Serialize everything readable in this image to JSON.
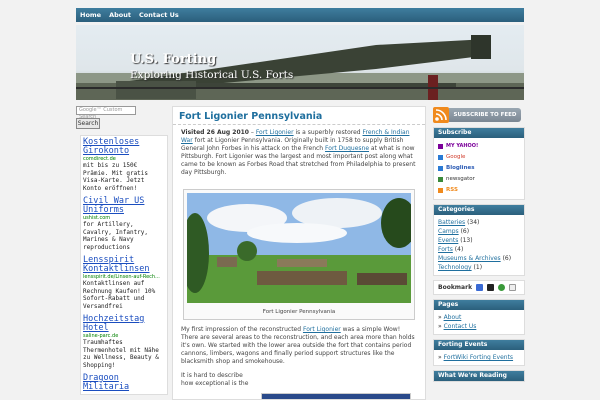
{
  "nav": [
    "Home",
    "About",
    "Contact Us"
  ],
  "site": {
    "title": "U.S. Forting",
    "description": "Exploring Historical U.S. Forts"
  },
  "search": {
    "placeholder": "Google™ Custom Search",
    "button": "Search"
  },
  "ads": [
    {
      "title": "Kostenloses Girokonto",
      "url": "comdirect.de",
      "text": "mit bis zu 150€ Prämie. Mit gratis Visa-Karte. Jetzt Konto eröffnen!"
    },
    {
      "title": "Civil War US Uniforms",
      "url": "ushist.com",
      "text": "for Artillery, Cavalry, Infantry, Marines & Navy reproductions"
    },
    {
      "title": "Lensspirit Kontaktlinsen",
      "url": "lensspirit.de/Linsen-auf-Rech...",
      "text": "Kontaktlinsen auf Rechnung Kaufen! 10% Sofort-Rabatt und Versandfrei"
    },
    {
      "title": "Hochzeitstag Hotel",
      "url": "saline-parc.de",
      "text": "Traumhaftes Thermenhotel mit Nähe zu Wellness, Beauty & Shopping!"
    },
    {
      "title": "Dragoon Militaria",
      "url": "",
      "text": ""
    }
  ],
  "post": {
    "title": "Fort Ligonier Pennsylvania",
    "meta": "Visited 26 Aug 2010",
    "intro_dash": " – ",
    "link1": "Fort Ligonier",
    "p1_a": " is a superbly restored ",
    "link2": "French & Indian War",
    "p1_b": " fort at Ligonier Pennsylvania. Originally built in 1758 to supply British General John Forbes in his attack on the French ",
    "link3": "Fort Duquesne",
    "p1_c": " at what is now Pittsburgh. Fort Ligonier was the largest and most important post along what came to be known as Forbes Road that stretched from Philadelphia to present day Pittsburgh.",
    "photo_caption": "Fort Ligonier Pennsylvania",
    "p2_a": "My first impression of the reconstructed ",
    "link4": "Fort Ligonier",
    "p2_b": " was a simple Wow! There are several areas to the reconstruction, and each area more than holds it's own. We started with the lower area outside the fort that contains period cannons, limbers, wagons and finally period support structures like the blacksmith shop and smokehouse.",
    "p3": "It is hard to describe how exceptional is the"
  },
  "sidebar": {
    "subscribe_label": "SUBSCRIBE TO FEED",
    "subscribe_heading": "Subscribe",
    "subscribe_items": [
      "MY YAHOO!",
      "Google",
      "Bloglines",
      "newsgator",
      "RSS"
    ],
    "categories_heading": "Categories",
    "categories": [
      {
        "name": "Batteries",
        "count": "(34)"
      },
      {
        "name": "Camps",
        "count": "(6)"
      },
      {
        "name": "Events",
        "count": "(13)"
      },
      {
        "name": "Forts",
        "count": "(4)"
      },
      {
        "name": "Museums & Archives",
        "count": "(6)"
      },
      {
        "name": "Technology",
        "count": "(1)"
      }
    ],
    "bookmark_label": "Bookmark",
    "pages_heading": "Pages",
    "pages": [
      "About",
      "Contact Us"
    ],
    "forting_events_heading": "Forting Events",
    "forting_events": [
      "FortWiki Forting Events"
    ],
    "reading_heading": "What We're Reading"
  },
  "colors": {
    "accent": "#2b5f7c",
    "link": "#1f6f9e",
    "rss": "#f08a1d"
  }
}
